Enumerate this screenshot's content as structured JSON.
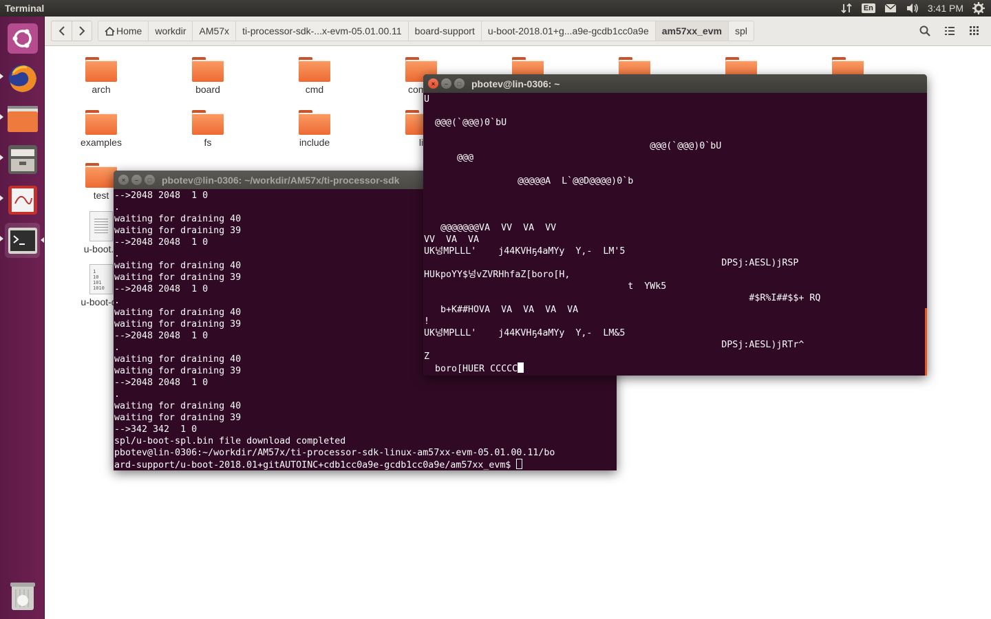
{
  "top_panel": {
    "app_title": "Terminal",
    "lang": "En",
    "clock": "3:41 PM",
    "icons": [
      "transfer-icon",
      "keyboard-language-icon",
      "mail-icon",
      "volume-icon",
      "clock",
      "settings-gear-icon"
    ]
  },
  "launcher": {
    "items": [
      "ubuntu-dash-icon",
      "firefox-icon",
      "files-icon",
      "archive-manager-icon",
      "document-viewer-icon",
      "terminal-icon",
      "trash-icon"
    ]
  },
  "file_manager": {
    "breadcrumb": [
      {
        "label": "Home",
        "icon": "home-icon"
      },
      {
        "label": "workdir"
      },
      {
        "label": "AM57x"
      },
      {
        "label": "ti-processor-sdk-...x-evm-05.01.00.11"
      },
      {
        "label": "board-support"
      },
      {
        "label": "u-boot-2018.01+g...a9e-gcdb1cc0a9e"
      },
      {
        "label": "am57xx_evm",
        "active": true
      },
      {
        "label": "spl"
      }
    ],
    "files": [
      {
        "name": "arch",
        "type": "folder"
      },
      {
        "name": "board",
        "type": "folder"
      },
      {
        "name": "cmd",
        "type": "folder"
      },
      {
        "name": "comm",
        "type": "folder"
      },
      {
        "name": "",
        "type": "folder"
      },
      {
        "name": "",
        "type": "folder"
      },
      {
        "name": "",
        "type": "folder"
      },
      {
        "name": "",
        "type": "folder"
      },
      {
        "name": "examples",
        "type": "folder"
      },
      {
        "name": "fs",
        "type": "folder"
      },
      {
        "name": "include",
        "type": "folder"
      },
      {
        "name": "li",
        "type": "folder"
      },
      {
        "name": "test",
        "type": "folder"
      },
      {
        "name": "u-boot.c",
        "type": "text"
      },
      {
        "name": "u-boot-dtl",
        "type": "binary"
      }
    ]
  },
  "terminal_back": {
    "title": "pbotev@lin-0306: ~/workdir/AM57x/ti-processor-sdk",
    "lines": [
      "-->2048 2048  1 0",
      ".",
      "waiting for draining 40",
      "waiting for draining 39",
      "-->2048 2048  1 0",
      ".",
      "waiting for draining 40",
      "waiting for draining 39",
      "-->2048 2048  1 0",
      ".",
      "waiting for draining 40",
      "waiting for draining 39",
      "-->2048 2048  1 0",
      ".",
      "waiting for draining 40",
      "waiting for draining 39",
      "-->2048 2048  1 0",
      ".",
      "waiting for draining 40",
      "waiting for draining 39",
      "-->342 342  1 0",
      "spl/u-boot-spl.bin file download completed",
      "pbotev@lin-0306:~/workdir/AM57x/ti-processor-sdk-linux-am57xx-evm-05.01.00.11/bo",
      "ard-support/u-boot-2018.01+gitAUTOINC+cdb1cc0a9e-gcdb1cc0a9e/am57xx_evm$ "
    ]
  },
  "terminal_front": {
    "title": "pbotev@lin-0306: ~",
    "lines": [
      "U",
      "",
      "  @@@(`@@@)0`bU",
      "",
      "                                         @@@(`@@@)0`bU",
      "      @@@",
      "",
      "                 @@@@@A  L`@@D@@@@)0`b",
      "",
      "",
      "",
      "   @@@@@@@VA  VV  VA  VV",
      "VV  VA  VA",
      "UK넝MPLLL'    j44KVHҕ4aMYy  Y,-  LM'5",
      "                                                      DPSj:AESL)jRSP",
      "HUkpoYY$넝vZVRHhfaZ[boro[H,",
      "                                     t  YWk5",
      "                                                           #$R%I##$$+ RQ",
      "   b+K##HOVA  VA  VA  VA  VA",
      "!",
      "UK넝MPLLL'    j44KVHҕ4aMYy  Y,-  LM&5",
      "                                                      DPSj:AESL)jRTr^",
      "Z",
      "  boro[HUER CCCCC"
    ]
  }
}
